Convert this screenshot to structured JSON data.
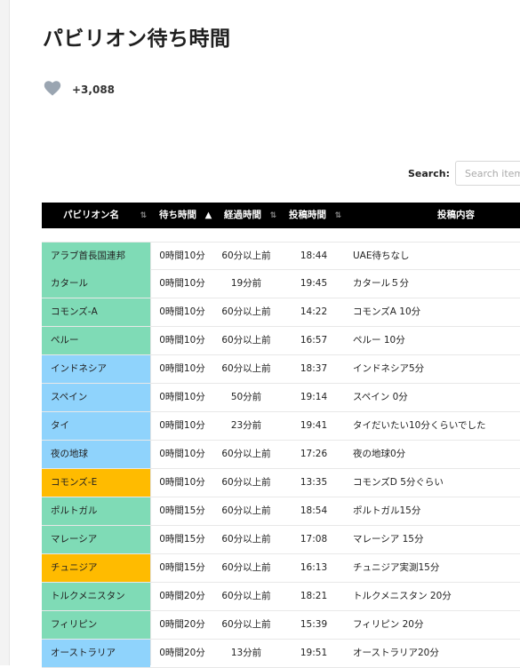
{
  "page": {
    "title": "パビリオン待ち時間"
  },
  "like": {
    "count": "+3,088"
  },
  "search": {
    "label": "Search:",
    "placeholder": "Search items"
  },
  "colors": {
    "green": "#7fdbb6",
    "blue": "#8fd3fc",
    "orange": "#ffbb00",
    "header_bg": "#000000"
  },
  "table": {
    "headers": {
      "pavilion": "パビリオン名",
      "wait": "待ち時間",
      "elapsed": "経過時間",
      "posted": "投稿時間",
      "content": "投稿内容"
    },
    "sort_icons": {
      "unsorted": "⇅",
      "ascending": "▲"
    },
    "rows": [
      {
        "pavilion": "アラブ首長国連邦",
        "wait": "0時間10分",
        "elapsed": "60分以上前",
        "posted": "18:44",
        "content": "UAE待ちなし",
        "color": "green"
      },
      {
        "pavilion": "カタール",
        "wait": "0時間10分",
        "elapsed": "19分前",
        "posted": "19:45",
        "content": "カタール５分",
        "color": "green"
      },
      {
        "pavilion": "コモンズ-A",
        "wait": "0時間10分",
        "elapsed": "60分以上前",
        "posted": "14:22",
        "content": "コモンズA 10分",
        "color": "green"
      },
      {
        "pavilion": "ペルー",
        "wait": "0時間10分",
        "elapsed": "60分以上前",
        "posted": "16:57",
        "content": "ペルー 10分",
        "color": "green"
      },
      {
        "pavilion": "インドネシア",
        "wait": "0時間10分",
        "elapsed": "60分以上前",
        "posted": "18:37",
        "content": "インドネシア5分",
        "color": "blue"
      },
      {
        "pavilion": "スペイン",
        "wait": "0時間10分",
        "elapsed": "50分前",
        "posted": "19:14",
        "content": "スペイン 0分",
        "color": "blue"
      },
      {
        "pavilion": "タイ",
        "wait": "0時間10分",
        "elapsed": "23分前",
        "posted": "19:41",
        "content": "タイだいたい10分くらいでした",
        "color": "blue"
      },
      {
        "pavilion": "夜の地球",
        "wait": "0時間10分",
        "elapsed": "60分以上前",
        "posted": "17:26",
        "content": "夜の地球0分",
        "color": "blue"
      },
      {
        "pavilion": "コモンズ-E",
        "wait": "0時間10分",
        "elapsed": "60分以上前",
        "posted": "13:35",
        "content": "コモンズD 5分ぐらい",
        "color": "orange"
      },
      {
        "pavilion": "ポルトガル",
        "wait": "0時間15分",
        "elapsed": "60分以上前",
        "posted": "18:54",
        "content": "ポルトガル15分",
        "color": "green"
      },
      {
        "pavilion": "マレーシア",
        "wait": "0時間15分",
        "elapsed": "60分以上前",
        "posted": "17:08",
        "content": "マレーシア 15分",
        "color": "green"
      },
      {
        "pavilion": "チュニジア",
        "wait": "0時間15分",
        "elapsed": "60分以上前",
        "posted": "16:13",
        "content": "チュニジア実測15分",
        "color": "orange"
      },
      {
        "pavilion": "トルクメニスタン",
        "wait": "0時間20分",
        "elapsed": "60分以上前",
        "posted": "18:21",
        "content": "トルクメニスタン 20分",
        "color": "green"
      },
      {
        "pavilion": "フィリピン",
        "wait": "0時間20分",
        "elapsed": "60分以上前",
        "posted": "15:39",
        "content": "フィリピン 20分",
        "color": "green"
      },
      {
        "pavilion": "オーストラリア",
        "wait": "0時間20分",
        "elapsed": "13分前",
        "posted": "19:51",
        "content": "オーストラリア20分",
        "color": "blue"
      }
    ]
  }
}
